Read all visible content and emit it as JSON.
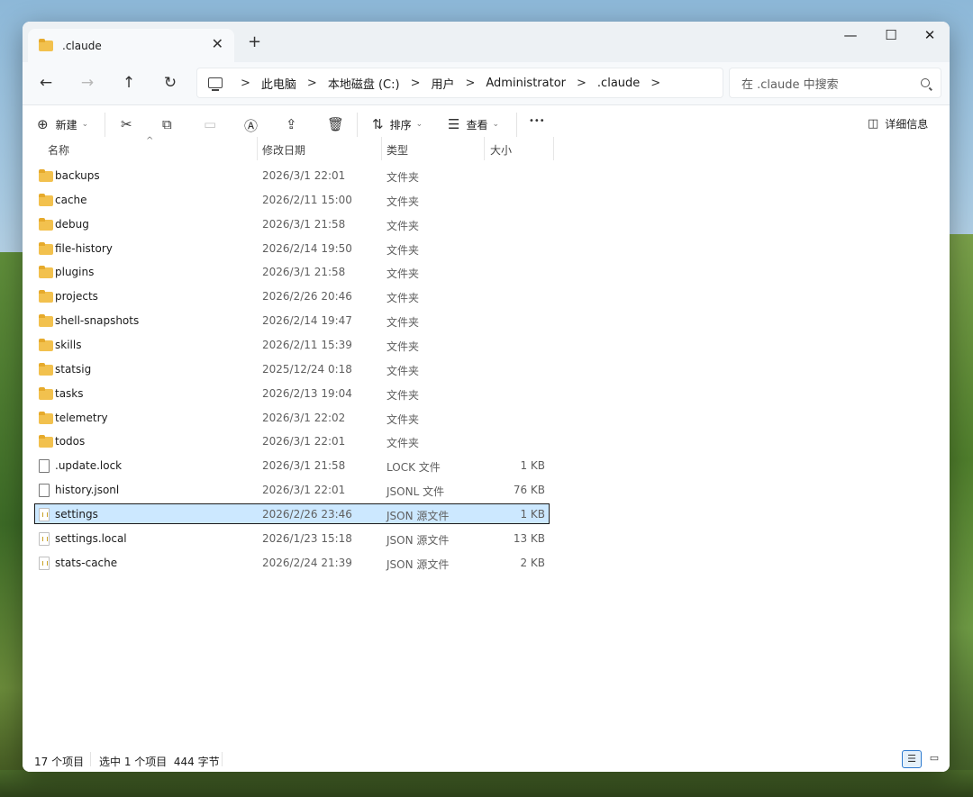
{
  "tab": {
    "title": ".claude",
    "close_glyph": "✕",
    "new_tab_glyph": "+"
  },
  "window_controls": {
    "minimize": "—",
    "maximize": "☐",
    "close": "✕"
  },
  "nav": {
    "back": "←",
    "forward": "→",
    "up": "↑",
    "refresh": "↻"
  },
  "breadcrumb": {
    "separator": ">",
    "items": [
      "此电脑",
      "本地磁盘 (C:)",
      "用户",
      "Administrator",
      ".claude"
    ]
  },
  "search": {
    "placeholder": "在 .claude 中搜索"
  },
  "toolbar": {
    "new_label": "新建",
    "sort_label": "排序",
    "view_label": "查看",
    "more_glyph": "•••",
    "details_label": "详细信息",
    "icons": [
      "plus-circle-icon",
      "cut-icon",
      "copy-icon",
      "paste-icon",
      "rename-icon",
      "share-icon",
      "delete-icon",
      "sort-icon",
      "view-icon",
      "more-icon",
      "details-pane-icon"
    ]
  },
  "columns": {
    "name": "名称",
    "date": "修改日期",
    "type": "类型",
    "size": "大小",
    "sort_caret": "^"
  },
  "files": [
    {
      "name": "backups",
      "date": "2026/3/1 22:01",
      "type": "文件夹",
      "size": "",
      "icon": "folder"
    },
    {
      "name": "cache",
      "date": "2026/2/11 15:00",
      "type": "文件夹",
      "size": "",
      "icon": "folder"
    },
    {
      "name": "debug",
      "date": "2026/3/1 21:58",
      "type": "文件夹",
      "size": "",
      "icon": "folder"
    },
    {
      "name": "file-history",
      "date": "2026/2/14 19:50",
      "type": "文件夹",
      "size": "",
      "icon": "folder"
    },
    {
      "name": "plugins",
      "date": "2026/3/1 21:58",
      "type": "文件夹",
      "size": "",
      "icon": "folder"
    },
    {
      "name": "projects",
      "date": "2026/2/26 20:46",
      "type": "文件夹",
      "size": "",
      "icon": "folder"
    },
    {
      "name": "shell-snapshots",
      "date": "2026/2/14 19:47",
      "type": "文件夹",
      "size": "",
      "icon": "folder"
    },
    {
      "name": "skills",
      "date": "2026/2/11 15:39",
      "type": "文件夹",
      "size": "",
      "icon": "folder"
    },
    {
      "name": "statsig",
      "date": "2025/12/24 0:18",
      "type": "文件夹",
      "size": "",
      "icon": "folder"
    },
    {
      "name": "tasks",
      "date": "2026/2/13 19:04",
      "type": "文件夹",
      "size": "",
      "icon": "folder"
    },
    {
      "name": "telemetry",
      "date": "2026/3/1 22:02",
      "type": "文件夹",
      "size": "",
      "icon": "folder"
    },
    {
      "name": "todos",
      "date": "2026/3/1 22:01",
      "type": "文件夹",
      "size": "",
      "icon": "folder"
    },
    {
      "name": ".update.lock",
      "date": "2026/3/1 21:58",
      "type": "LOCK 文件",
      "size": "1 KB",
      "icon": "file"
    },
    {
      "name": "history.jsonl",
      "date": "2026/3/1 22:01",
      "type": "JSONL 文件",
      "size": "76 KB",
      "icon": "file"
    },
    {
      "name": "settings",
      "date": "2026/2/26 23:46",
      "type": "JSON 源文件",
      "size": "1 KB",
      "icon": "json",
      "selected": true
    },
    {
      "name": "settings.local",
      "date": "2026/1/23 15:18",
      "type": "JSON 源文件",
      "size": "13 KB",
      "icon": "json"
    },
    {
      "name": "stats-cache",
      "date": "2026/2/24 21:39",
      "type": "JSON 源文件",
      "size": "2 KB",
      "icon": "json"
    }
  ],
  "status": {
    "item_count": "17 个项目",
    "selection": "选中 1 个项目  444 字节"
  },
  "colors": {
    "selection_bg": "#cce8ff",
    "folder": "#f2c14e",
    "accent": "#2e7bcf"
  }
}
